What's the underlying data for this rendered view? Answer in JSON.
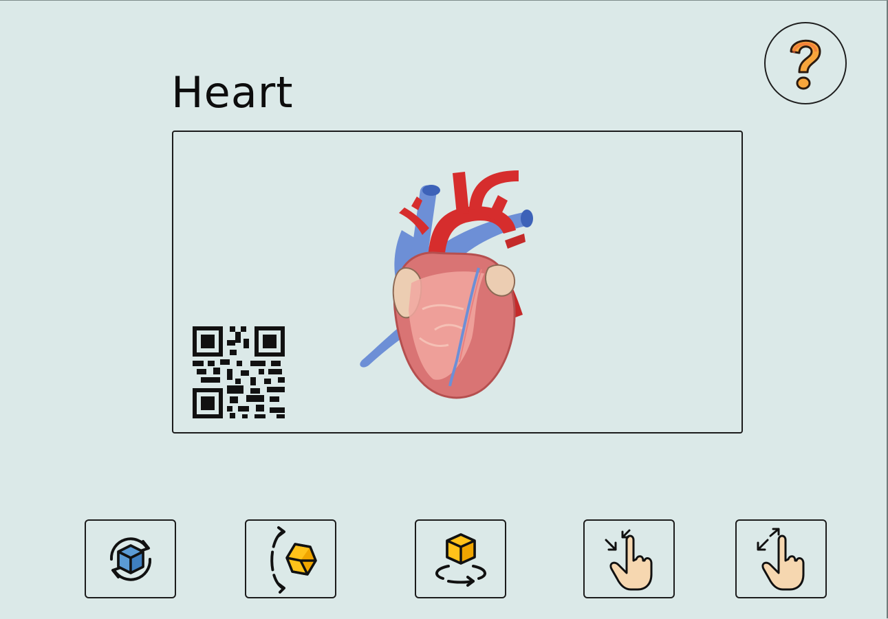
{
  "page": {
    "title": "Heart"
  },
  "help": {
    "icon": "question-mark-icon"
  },
  "viewer": {
    "model": "heart-model",
    "qr": "qr-code"
  },
  "toolbar": [
    {
      "id": "rotate",
      "icon": "rotate-cube-icon"
    },
    {
      "id": "flip",
      "icon": "flip-cube-icon"
    },
    {
      "id": "turn",
      "icon": "turn-cube-icon"
    },
    {
      "id": "pinch",
      "icon": "pinch-zoom-in-icon"
    },
    {
      "id": "spread",
      "icon": "spread-zoom-out-icon"
    }
  ],
  "colors": {
    "background": "#dbe9e8",
    "border": "#1b1b1b",
    "cube_blue": "#5b9bd5",
    "cube_yellow": "#ffc21a",
    "help_orange": "#f08a3c",
    "skin": "#f6d7b0"
  }
}
